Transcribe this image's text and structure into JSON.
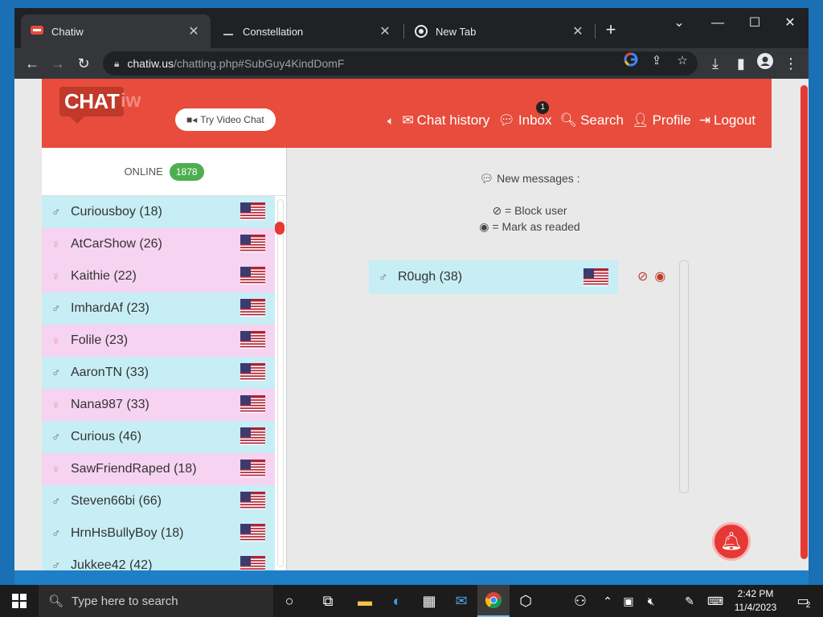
{
  "browser": {
    "tabs": [
      {
        "title": "Chatiw",
        "active": true
      },
      {
        "title": "Constellation",
        "active": false
      },
      {
        "title": "New Tab",
        "active": false
      }
    ],
    "url_domain": "chatiw.us",
    "url_path": "/chatting.php#SubGuy4KindDomF"
  },
  "header": {
    "logo_text": "CHAT",
    "logo_suffix": "iw",
    "video_btn": "Try Video Chat",
    "nav": {
      "chat_history": "Chat history",
      "inbox": "Inbox",
      "inbox_count": "1",
      "search": "Search",
      "profile": "Profile",
      "logout": "Logout"
    }
  },
  "sidebar": {
    "online_label": "ONLINE",
    "online_count": "1878",
    "users": [
      {
        "name": "Curiousboy (18)",
        "gender": "m"
      },
      {
        "name": "AtCarShow (26)",
        "gender": "f"
      },
      {
        "name": "Kaithie (22)",
        "gender": "f"
      },
      {
        "name": "ImhardAf (23)",
        "gender": "m"
      },
      {
        "name": "Folile (23)",
        "gender": "f"
      },
      {
        "name": "AaronTN (33)",
        "gender": "m"
      },
      {
        "name": "Nana987 (33)",
        "gender": "f"
      },
      {
        "name": "Curious (46)",
        "gender": "m"
      },
      {
        "name": "SawFriendRaped (18)",
        "gender": "f"
      },
      {
        "name": "Steven66bi (66)",
        "gender": "m"
      },
      {
        "name": "HrnHsBullyBoy (18)",
        "gender": "m"
      },
      {
        "name": "Jukkee42 (42)",
        "gender": "m"
      }
    ]
  },
  "main": {
    "new_messages": "New messages :",
    "block_legend": "= Block user",
    "mark_legend": "= Mark as readed",
    "conversation": {
      "name": "R0ugh (38)",
      "gender": "m"
    }
  },
  "taskbar": {
    "search_placeholder": "Type here to search",
    "time": "2:42 PM",
    "date": "11/4/2023",
    "notification_count": "2"
  }
}
